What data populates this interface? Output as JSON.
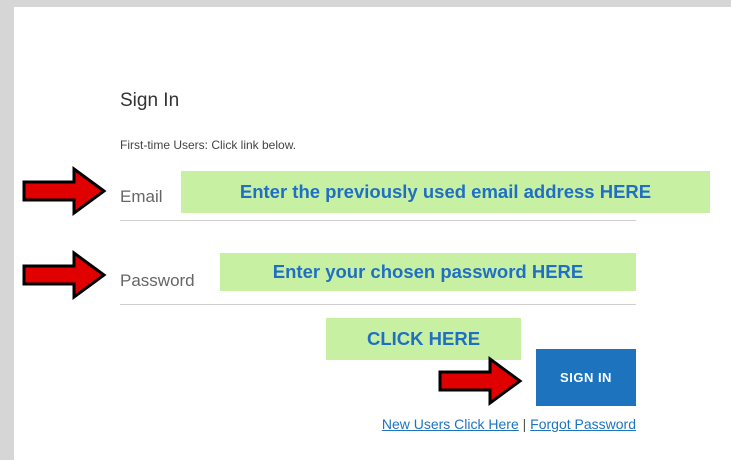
{
  "form": {
    "title": "Sign In",
    "hint": "First-time Users: Click link below.",
    "email_label": "Email",
    "password_label": "Password",
    "signin_button": "SIGN IN"
  },
  "links": {
    "new_users": "New Users Click Here",
    "separator": "|",
    "forgot_password": "Forgot Password"
  },
  "annotations": {
    "email_callout": "Enter the previously used email address HERE",
    "password_callout": "Enter your chosen password HERE",
    "click_callout": "CLICK HERE"
  },
  "colors": {
    "callout_bg": "#c7f0a3",
    "callout_text": "#1f6fc4",
    "button_bg": "#1e73be",
    "arrow_fill": "#e00000"
  }
}
